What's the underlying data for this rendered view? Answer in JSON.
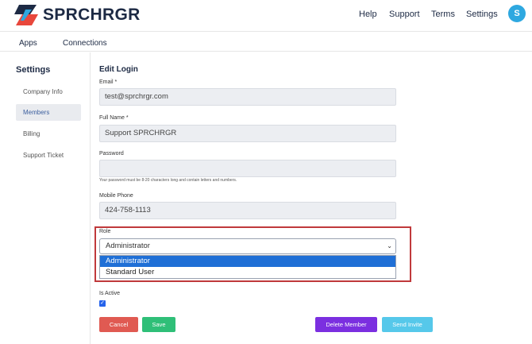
{
  "header": {
    "brand": "SPRCHRGR",
    "nav": [
      "Help",
      "Support",
      "Terms",
      "Settings"
    ],
    "avatar_initial": "S"
  },
  "subnav": {
    "tabs": [
      "Apps",
      "Connections"
    ]
  },
  "sidebar": {
    "title": "Settings",
    "items": [
      {
        "label": "Company Info",
        "active": false
      },
      {
        "label": "Members",
        "active": true
      },
      {
        "label": "Billing",
        "active": false
      },
      {
        "label": "Support Ticket",
        "active": false
      }
    ]
  },
  "form": {
    "title": "Edit Login",
    "email": {
      "label": "Email *",
      "value": "test@sprchrgr.com"
    },
    "full_name": {
      "label": "Full Name *",
      "value": "Support SPRCHRGR"
    },
    "password": {
      "label": "Password",
      "value": "",
      "hint": "Your password must be 8-20 characters long and contain letters and numbers."
    },
    "mobile": {
      "label": "Mobile Phone",
      "value": "424-758-1113"
    },
    "role": {
      "label": "Role",
      "selected": "Administrator",
      "options": [
        "Administrator",
        "Standard User"
      ]
    },
    "is_active": {
      "label": "Is Active",
      "checked": true
    }
  },
  "buttons": {
    "cancel": "Cancel",
    "save": "Save",
    "delete": "Delete Member",
    "invite": "Send Invite"
  },
  "colors": {
    "brand_navy": "#1d2a44",
    "avatar": "#2ea8e0",
    "cancel": "#e05a52",
    "save": "#2fbf78",
    "delete": "#7b2fe0",
    "invite": "#56c8ea",
    "highlight": "#c0393b",
    "option_selected": "#1f6fd6"
  }
}
